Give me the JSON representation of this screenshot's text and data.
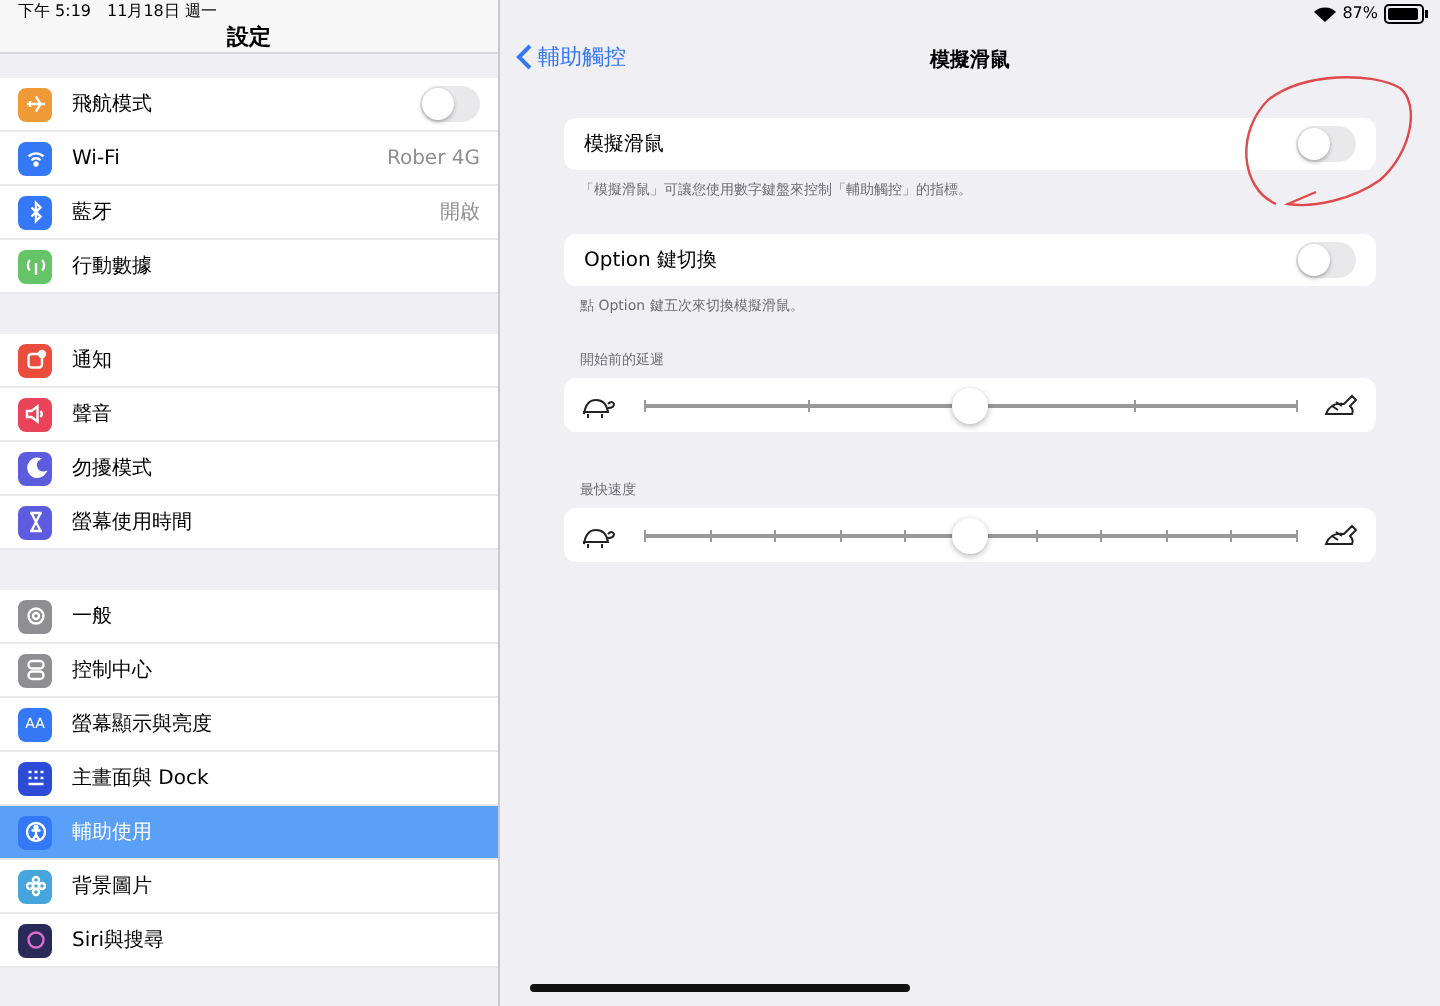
{
  "status_bar": {
    "time": "下午 5:19",
    "date": "11月18日 週一",
    "battery": "87%"
  },
  "sidebar": {
    "title": "設定",
    "groups": [
      {
        "items": [
          {
            "label": "飛航模式",
            "color": "#f09a37",
            "kind": "toggle",
            "on": false,
            "selected": false
          },
          {
            "label": "Wi-Fi",
            "color": "#3478f6",
            "kind": "value",
            "value": "Rober 4G",
            "selected": false
          },
          {
            "label": "藍牙",
            "color": "#3478f6",
            "kind": "value",
            "value": "開啟",
            "selected": false
          },
          {
            "label": "行動數據",
            "color": "#65c466",
            "kind": "plain",
            "selected": false
          }
        ]
      },
      {
        "items": [
          {
            "label": "通知",
            "color": "#eb4d3d",
            "kind": "plain",
            "selected": false
          },
          {
            "label": "聲音",
            "color": "#eb445a",
            "kind": "plain",
            "selected": false
          },
          {
            "label": "勿擾模式",
            "color": "#5d5cde",
            "kind": "plain",
            "selected": false
          },
          {
            "label": "螢幕使用時間",
            "color": "#5d5cde",
            "kind": "plain",
            "selected": false
          }
        ]
      },
      {
        "items": [
          {
            "label": "一般",
            "color": "#8e8e93",
            "kind": "plain",
            "selected": false
          },
          {
            "label": "控制中心",
            "color": "#8e8e93",
            "kind": "plain",
            "selected": false
          },
          {
            "label": "螢幕顯示與亮度",
            "color": "#3478f6",
            "icon_text": "AA",
            "kind": "plain",
            "selected": false
          },
          {
            "label": "主畫面與 Dock",
            "color": "#2c4bd6",
            "kind": "plain",
            "selected": false
          },
          {
            "label": "輔助使用",
            "color": "#3478f6",
            "kind": "plain",
            "selected": true
          },
          {
            "label": "背景圖片",
            "color": "#45a5dc",
            "kind": "plain",
            "selected": false
          },
          {
            "label": "Siri與搜尋",
            "color": "#2a2a5a",
            "kind": "plain",
            "selected": false
          }
        ]
      }
    ]
  },
  "detail": {
    "back": "輔助觸控",
    "title": "模擬滑鼠",
    "sections": [
      {
        "kind": "toggle",
        "label": "模擬滑鼠",
        "on": false,
        "footer": "「模擬滑鼠」可讓您使用數字鍵盤來控制「輔助觸控」的指標。",
        "circled": true
      },
      {
        "kind": "toggle",
        "label": "Option 鍵切換",
        "on": false,
        "footer": "點 Option 鍵五次來切換模擬滑鼠。",
        "circled": false
      },
      {
        "kind": "coarseslider",
        "header": "開始前的延遲",
        "level": 0.5
      },
      {
        "kind": "fineslider",
        "header": "最快速度",
        "level": 0.5
      }
    ]
  }
}
